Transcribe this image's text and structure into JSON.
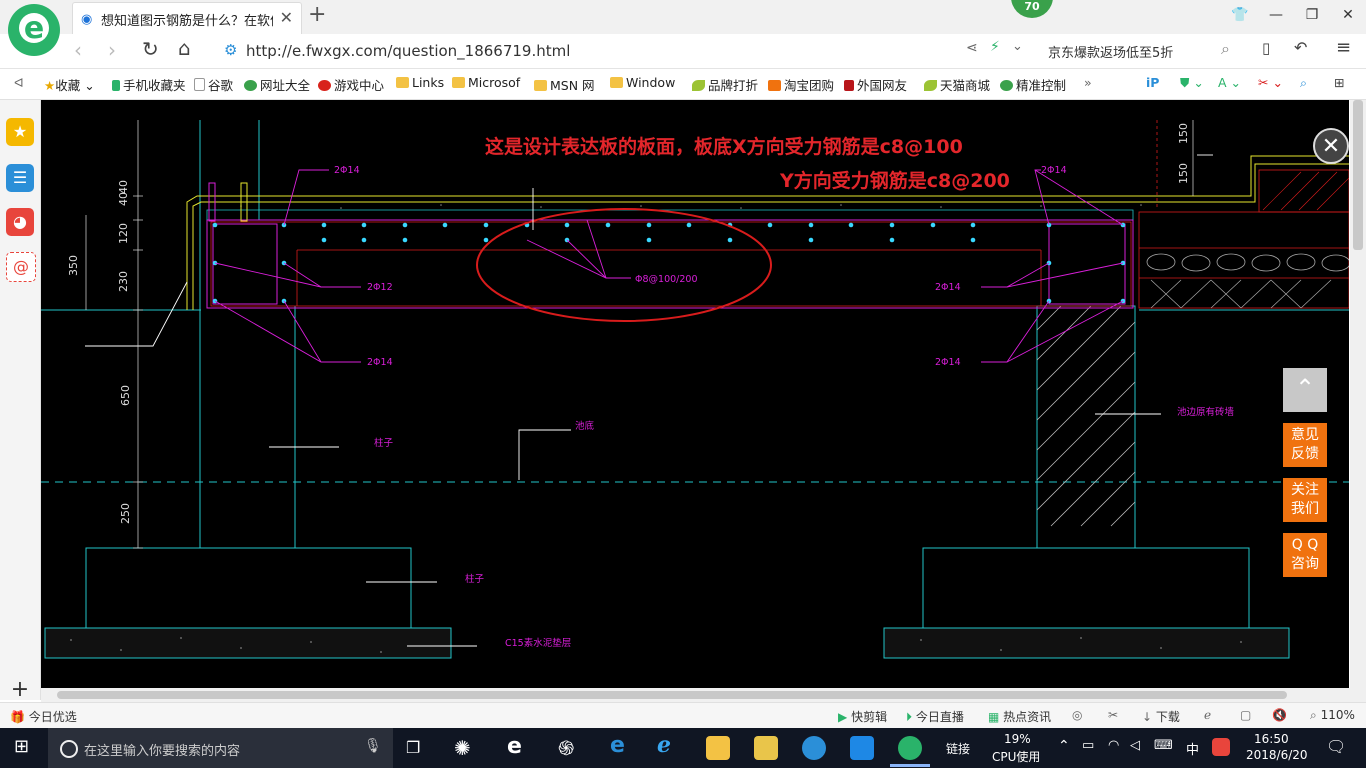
{
  "browser": {
    "tab_title": "想知道图示钢筋是什么？在软件中",
    "badge": "70",
    "url": "http://e.fwxgx.com/question_1866719.html",
    "search_text": "京东爆款返场低至5折"
  },
  "bookmarks": [
    {
      "label": "收藏",
      "icon": "star-icon"
    },
    {
      "label": "手机收藏夹",
      "icon": "phone-icon"
    },
    {
      "label": "谷歌",
      "icon": "page-icon"
    },
    {
      "label": "网址大全",
      "icon": "globe-icon"
    },
    {
      "label": "游戏中心",
      "icon": "game-icon"
    },
    {
      "label": "Links",
      "icon": "folder-icon"
    },
    {
      "label": "Microsof",
      "icon": "folder-icon"
    },
    {
      "label": "MSN 网",
      "icon": "folder-icon"
    },
    {
      "label": "Window",
      "icon": "folder-icon"
    },
    {
      "label": "品牌打折",
      "icon": "leaf-icon"
    },
    {
      "label": "淘宝团购",
      "icon": "taobao-icon"
    },
    {
      "label": "外国网友",
      "icon": "flag-icon"
    },
    {
      "label": "天猫商城",
      "icon": "leaf-icon"
    },
    {
      "label": "精准控制",
      "icon": "wechat-icon"
    }
  ],
  "drawing": {
    "annotation_line1": "这是设计表达板的板面，板底X方向受力钢筋是c8@100",
    "annotation_line2": "Y方向受力钢筋是c8@200",
    "labels": {
      "top_2phi14": "2Φ14",
      "left_2phi12": "2Φ12",
      "left_2phi14": "2Φ14",
      "right_2phi14_top": "2Φ14",
      "right_2phi14_mid": "2Φ14",
      "right_2phi14_low": "2Φ14",
      "phi8": "Φ8@100/200",
      "column1": "柱子",
      "column2": "柱子",
      "pool_bottom": "池底",
      "brick_wall": "池边原有砖墙",
      "cushion": "C15素水泥垫层"
    },
    "dims": [
      "40",
      "40",
      "120",
      "230",
      "350",
      "650",
      "250",
      "150",
      "150"
    ]
  },
  "side_buttons": {
    "feedback": [
      "意见",
      "反馈"
    ],
    "follow": [
      "关注",
      "我们"
    ],
    "qq": [
      "Q Q",
      "咨询"
    ]
  },
  "status": {
    "today_pick": "今日优选",
    "quick_cut": "快剪辑",
    "live": "今日直播",
    "news": "热点资讯",
    "download": "下载",
    "zoom": "110%"
  },
  "taskbar": {
    "search_placeholder": "在这里输入你要搜索的内容",
    "link_label": "链接",
    "cpu_percent": "19%",
    "cpu_label": "CPU使用",
    "lang": "中",
    "time": "16:50",
    "date": "2018/6/20"
  },
  "colors": {
    "cyan": "#22c5c9",
    "magenta": "#d91fd9",
    "yellow": "#e6e62e",
    "red": "#d81c1c",
    "dot": "#39d8ff"
  }
}
